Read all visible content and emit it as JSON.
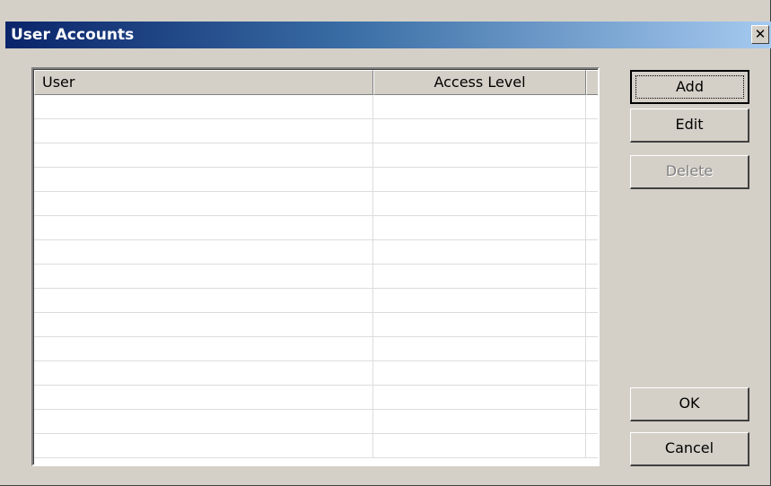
{
  "window": {
    "title": "User Accounts",
    "close_glyph": "✕"
  },
  "list": {
    "columns": [
      "User",
      "Access Level"
    ],
    "rows": []
  },
  "buttons": {
    "add": "Add",
    "edit": "Edit",
    "delete": "Delete",
    "ok": "OK",
    "cancel": "Cancel"
  },
  "state": {
    "delete_enabled": false,
    "default_button": "add"
  }
}
